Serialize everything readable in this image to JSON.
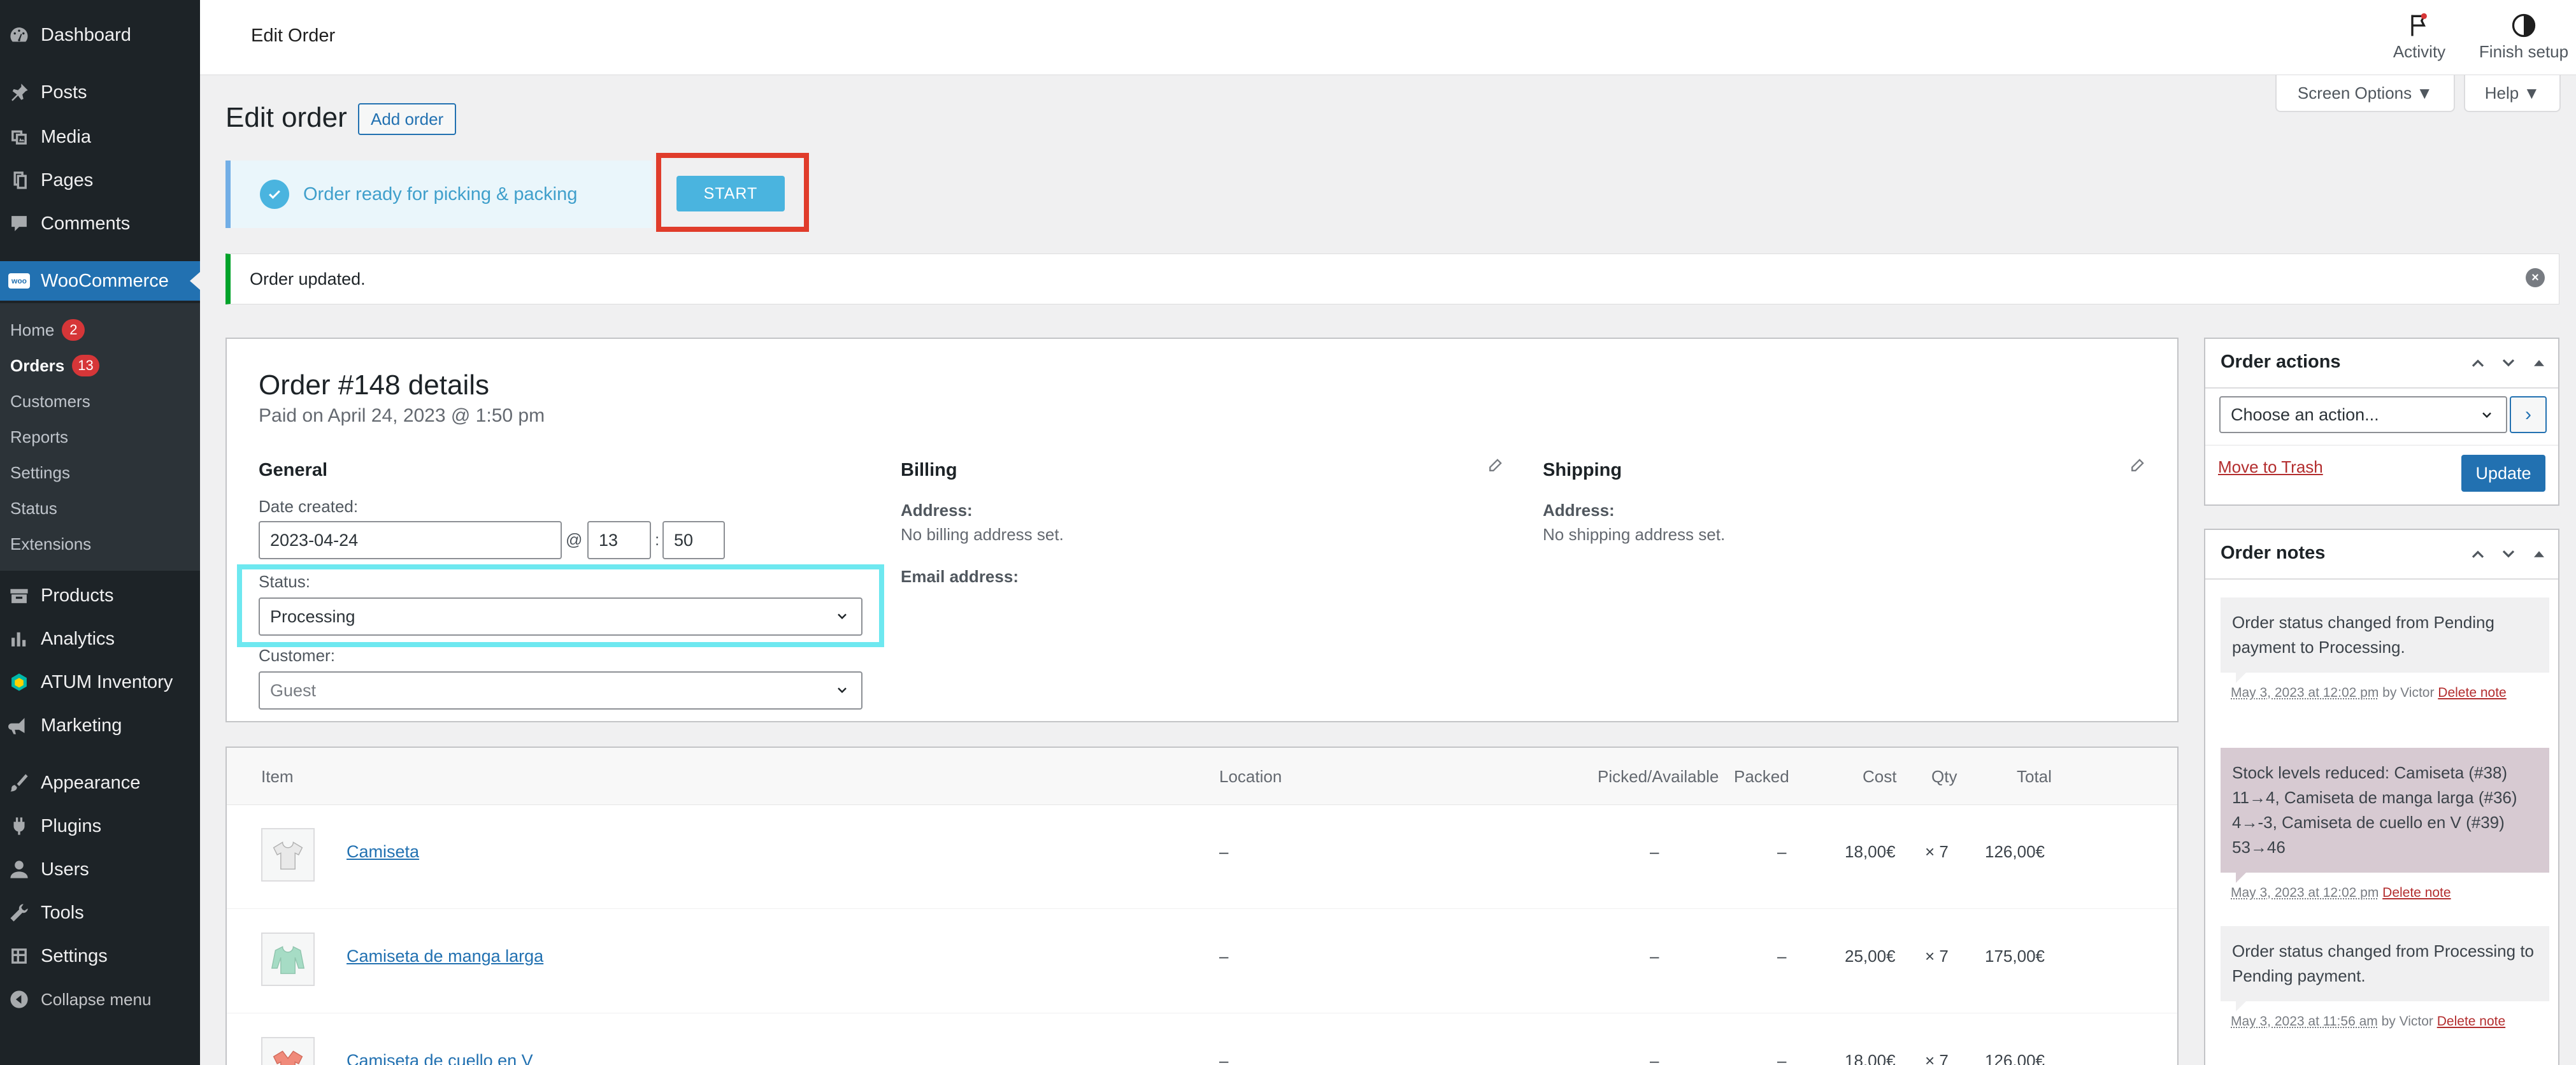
{
  "sidebar": {
    "items": [
      {
        "label": "Dashboard",
        "icon": "dashboard-icon"
      },
      {
        "label": "Posts",
        "icon": "pin-icon"
      },
      {
        "label": "Media",
        "icon": "media-icon"
      },
      {
        "label": "Pages",
        "icon": "pages-icon"
      },
      {
        "label": "Comments",
        "icon": "comment-icon"
      },
      {
        "label": "WooCommerce",
        "icon": "woo-icon"
      },
      {
        "label": "Products",
        "icon": "archive-icon"
      },
      {
        "label": "Analytics",
        "icon": "chart-icon"
      },
      {
        "label": "ATUM Inventory",
        "icon": "atum-icon"
      },
      {
        "label": "Marketing",
        "icon": "megaphone-icon"
      },
      {
        "label": "Appearance",
        "icon": "brush-icon"
      },
      {
        "label": "Plugins",
        "icon": "plug-icon"
      },
      {
        "label": "Users",
        "icon": "user-icon"
      },
      {
        "label": "Tools",
        "icon": "wrench-icon"
      },
      {
        "label": "Settings",
        "icon": "settings-icon"
      },
      {
        "label": "Collapse menu",
        "icon": "collapse-icon"
      }
    ],
    "woo_logo_text": "woo",
    "submenu": [
      {
        "label": "Home",
        "badge": "2"
      },
      {
        "label": "Orders",
        "badge": "13"
      },
      {
        "label": "Customers",
        "badge": ""
      },
      {
        "label": "Reports",
        "badge": ""
      },
      {
        "label": "Settings",
        "badge": ""
      },
      {
        "label": "Status",
        "badge": ""
      },
      {
        "label": "Extensions",
        "badge": ""
      }
    ]
  },
  "header": {
    "title": "Edit Order",
    "activity_label": "Activity",
    "finish_setup_label": "Finish setup",
    "screen_options_label": "Screen Options ▼",
    "help_label": "Help ▼"
  },
  "page": {
    "title": "Edit order",
    "add_order_label": "Add order"
  },
  "picking_notice": {
    "text": "Order ready for picking & packing",
    "start_label": "START"
  },
  "updated_notice": {
    "text": "Order updated.",
    "dismiss_symbol": "×"
  },
  "order": {
    "heading": "Order #148 details",
    "paid_on": "Paid on April 24, 2023 @ 1:50 pm",
    "general_heading": "General",
    "date_created_label": "Date created:",
    "date_value": "2023-04-24",
    "at_symbol": "@",
    "hour_value": "13",
    "colon": ":",
    "minute_value": "50",
    "status_label": "Status:",
    "status_value": "Processing",
    "customer_label": "Customer:",
    "customer_value": "Guest",
    "billing_heading": "Billing",
    "billing_address_label": "Address:",
    "billing_address_value": "No billing address set.",
    "email_label": "Email address:",
    "shipping_heading": "Shipping",
    "shipping_address_label": "Address:",
    "shipping_address_value": "No shipping address set."
  },
  "items_table": {
    "headers": {
      "item": "Item",
      "location": "Location",
      "picked": "Picked/Available",
      "packed": "Packed",
      "cost": "Cost",
      "qty": "Qty",
      "total": "Total"
    },
    "rows": [
      {
        "name": "Camiseta",
        "location": "–",
        "picked": "–",
        "packed": "–",
        "cost": "18,00€",
        "qty": "× 7",
        "total": "126,00€",
        "color": "#e9e9e9"
      },
      {
        "name": "Camiseta de manga larga",
        "location": "–",
        "picked": "–",
        "packed": "–",
        "cost": "25,00€",
        "qty": "× 7",
        "total": "175,00€",
        "color": "#a6dcc5"
      },
      {
        "name": "Camiseta de cuello en V",
        "location": "–",
        "picked": "–",
        "packed": "–",
        "cost": "18,00€",
        "qty": "× 7",
        "total": "126,00€",
        "color": "#f08a7a"
      }
    ]
  },
  "order_actions": {
    "title": "Order actions",
    "select_value": "Choose an action...",
    "go_symbol": "›",
    "trash_label": "Move to Trash",
    "update_label": "Update"
  },
  "order_notes": {
    "title": "Order notes",
    "notes": [
      {
        "text": "Order status changed from Pending payment to Processing.",
        "timestamp": "May 3, 2023 at 12:02 pm",
        "by": " by Victor ",
        "delete": "Delete note"
      },
      {
        "text": "Stock levels reduced: Camiseta (#38) 11→4, Camiseta de manga larga (#36) 4→-3, Camiseta de cuello en V (#39) 53→46",
        "timestamp": "May 3, 2023 at 12:02 pm",
        "by": " ",
        "delete": "Delete note"
      },
      {
        "text": "Order status changed from Processing to Pending payment.",
        "timestamp": "May 3, 2023 at 11:56 am",
        "by": " by Victor ",
        "delete": "Delete note"
      }
    ]
  },
  "colors": {
    "sidebar_bg": "#1d2327",
    "accent": "#2271b1",
    "success": "#00a32a",
    "highlight_red": "#e03c2b",
    "highlight_cyan": "#6ee8f0",
    "start_button": "#4ab4df"
  }
}
